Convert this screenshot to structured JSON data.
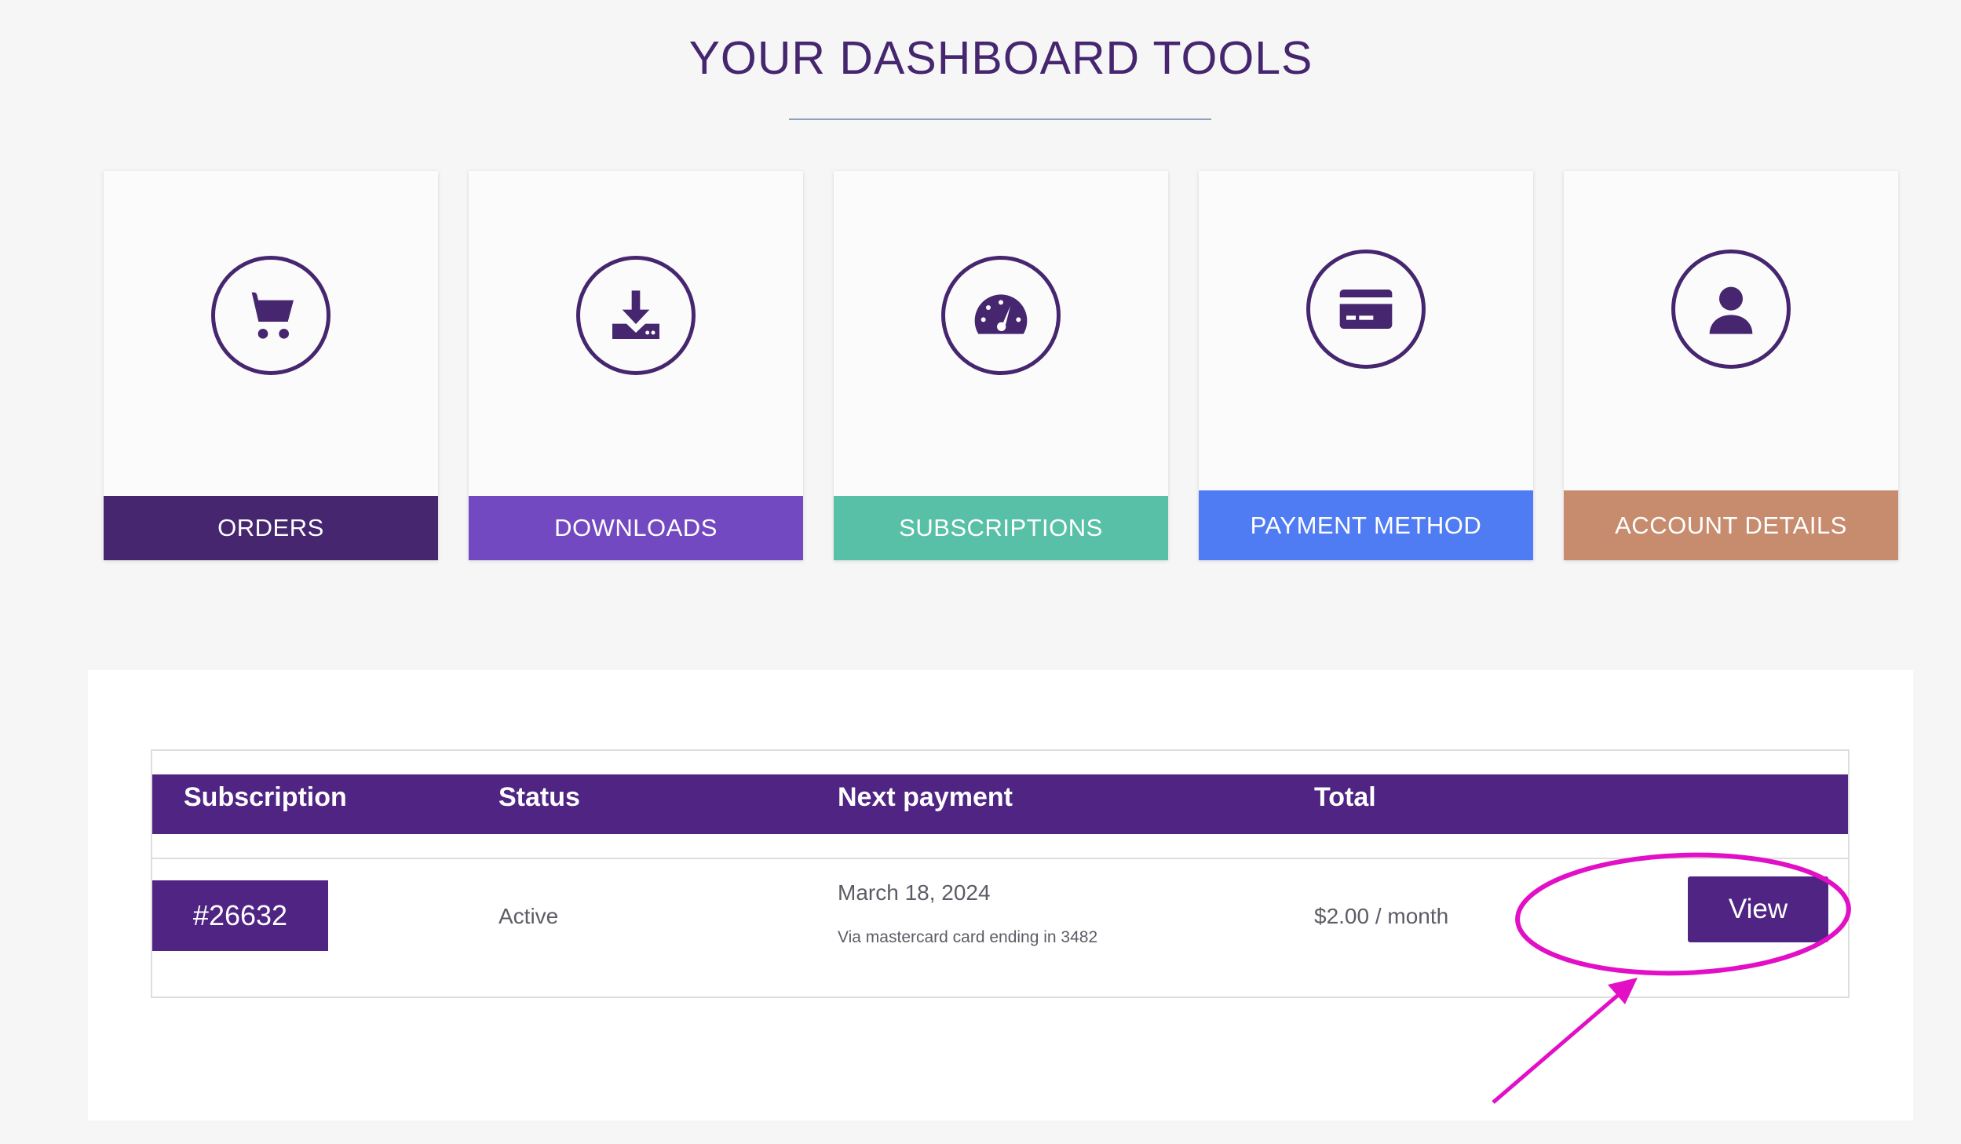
{
  "header": {
    "title": "YOUR DASHBOARD TOOLS"
  },
  "tools": [
    {
      "label": "ORDERS",
      "icon": "cart-icon",
      "color": "#45266f"
    },
    {
      "label": "DOWNLOADS",
      "icon": "download-icon",
      "color": "#7349c2"
    },
    {
      "label": "SUBSCRIPTIONS",
      "icon": "speedometer-icon",
      "color": "#58c0a7"
    },
    {
      "label": "PAYMENT METHOD",
      "icon": "credit-card-icon",
      "color": "#507cf3"
    },
    {
      "label": "ACCOUNT DETAILS",
      "icon": "user-icon",
      "color": "#c78c6d"
    }
  ],
  "subscriptions": {
    "columns": [
      "Subscription",
      "Status",
      "Next payment",
      "Total"
    ],
    "rows": [
      {
        "id": "#26632",
        "status": "Active",
        "next_payment": "March 18, 2024",
        "payment_note": "Via mastercard card ending in 3482",
        "total": "$2.00 / month",
        "action": "View"
      }
    ]
  },
  "colors": {
    "brand_purple": "#4f2483",
    "title": "#45266f",
    "annotation": "#e20fc6"
  }
}
